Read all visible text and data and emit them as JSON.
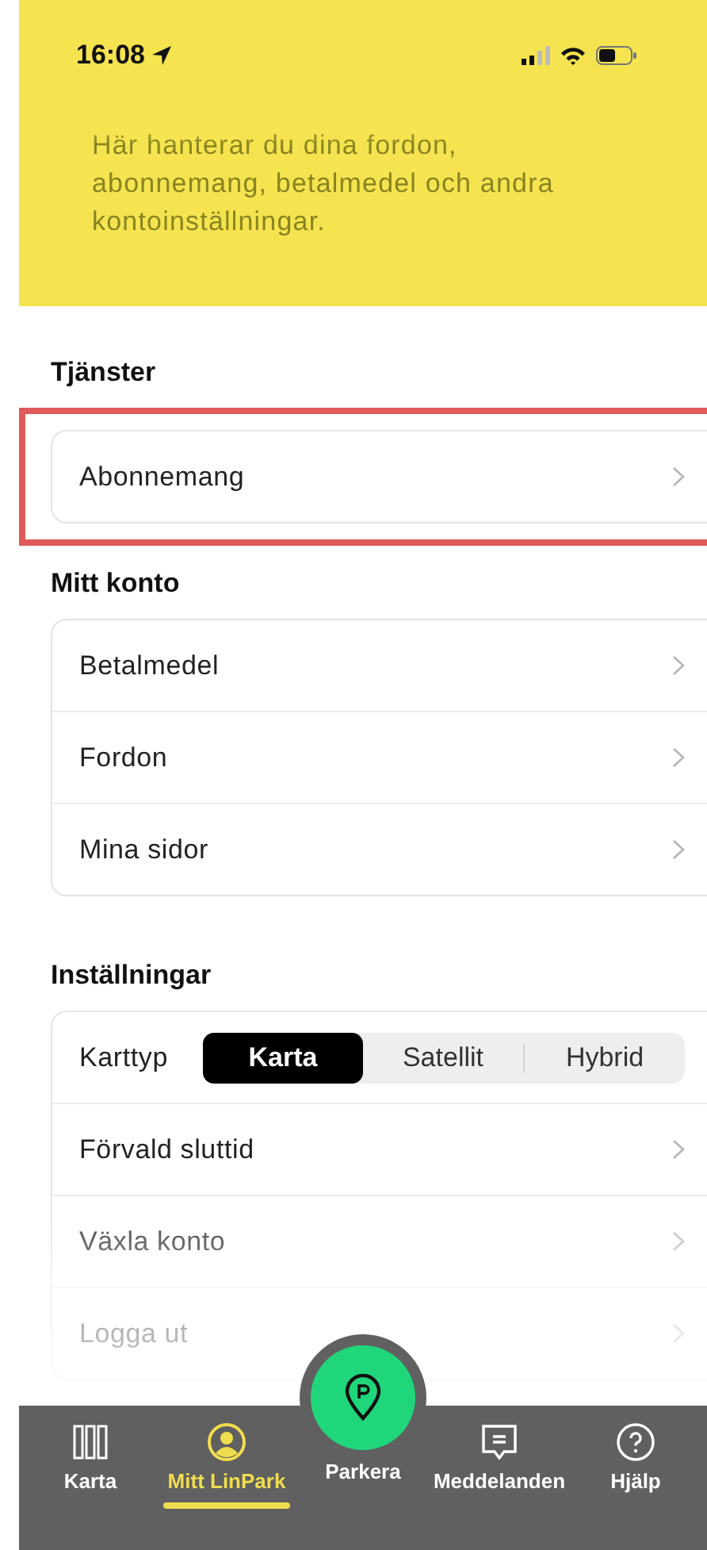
{
  "status_bar": {
    "time": "16:08"
  },
  "header": {
    "description": "Här hanterar du dina fordon, abonnemang, betalmedel och andra kontoinställningar."
  },
  "sections": [
    {
      "title": "Tjänster",
      "highlighted": true,
      "rows": [
        {
          "kind": "link",
          "label": "Abonnemang"
        }
      ]
    },
    {
      "title": "Mitt konto",
      "highlighted": false,
      "rows": [
        {
          "kind": "link",
          "label": "Betalmedel"
        },
        {
          "kind": "link",
          "label": "Fordon"
        },
        {
          "kind": "link",
          "label": "Mina sidor"
        }
      ]
    },
    {
      "title": "Inställningar",
      "highlighted": false,
      "rows": [
        {
          "kind": "segmented",
          "label": "Karttyp",
          "options": [
            {
              "label": "Karta",
              "selected": true
            },
            {
              "label": "Satellit",
              "selected": false
            },
            {
              "label": "Hybrid",
              "selected": false
            }
          ]
        },
        {
          "kind": "link",
          "label": "Förvald sluttid"
        },
        {
          "kind": "link",
          "label": "Växla konto"
        },
        {
          "kind": "link",
          "label": "Logga ut"
        }
      ]
    }
  ],
  "tab_bar": {
    "tabs": [
      {
        "kind": "tab",
        "label": "Karta",
        "selected": false
      },
      {
        "kind": "tab",
        "label": "Mitt LinPark",
        "selected": true
      },
      {
        "kind": "fab",
        "label": "Parkera",
        "selected": false
      },
      {
        "kind": "tab",
        "label": "Meddelanden",
        "selected": false
      },
      {
        "kind": "tab",
        "label": "Hjälp",
        "selected": false
      }
    ]
  }
}
